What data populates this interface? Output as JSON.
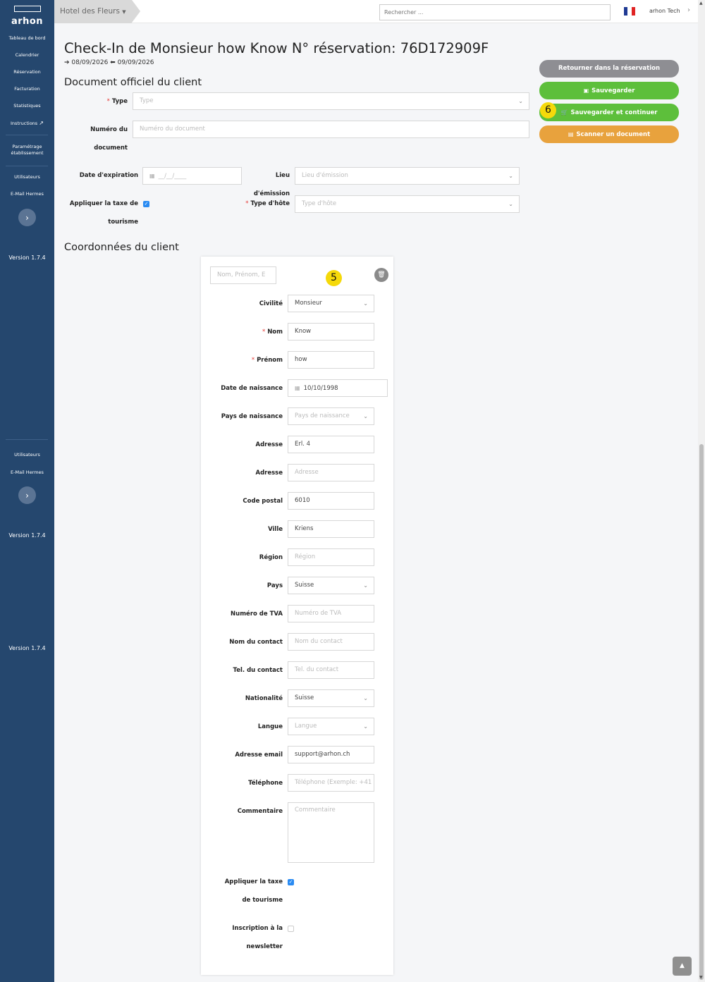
{
  "sidebar": {
    "logo": "arhon",
    "items": [
      "Tableau de bord",
      "Calendrier",
      "Réservation",
      "Facturation",
      "Statistiques",
      "Instructions"
    ],
    "settings": "Paramétrage établissement",
    "secondary": [
      "Utilisateurs",
      "E-Mail Hermes"
    ],
    "version": "Version 1.7.4"
  },
  "topbar": {
    "hotel": "Hotel des Fleurs",
    "search_placeholder": "Rechercher ...",
    "user": "arhon Tech",
    "flag_colors": [
      "#1f3a93",
      "#ffffff",
      "#e02424"
    ]
  },
  "header": {
    "title": "Check-In de Monsieur how Know N° réservation: 76D172909F",
    "arrival": "08/09/2026",
    "departure": "09/09/2026"
  },
  "actions": {
    "back": "Retourner dans la réservation",
    "save": "Sauvegarder",
    "save_continue": "Sauvegarder et continuer",
    "scan": "Scanner un document"
  },
  "markers": {
    "save_continue": "6",
    "client_card": "5"
  },
  "document": {
    "section_title": "Document officiel du client",
    "type_label": "Type",
    "type_placeholder": "Type",
    "number_label": "Numéro du document",
    "number_placeholder": "Numéro du document",
    "expiry_label": "Date d'expiration",
    "expiry_placeholder": "__/__/____",
    "emission_label": "Lieu d'émission",
    "emission_placeholder": "Lieu d'émission",
    "tax_label": "Appliquer la taxe de tourisme",
    "tax_checked": true,
    "guest_type_label": "Type d'hôte",
    "guest_type_placeholder": "Type d'hôte"
  },
  "client": {
    "section_title": "Coordonnées du client",
    "search_placeholder": "Nom, Prénom, E",
    "civility_label": "Civilité",
    "civility_value": "Monsieur",
    "lastname_label": "Nom",
    "lastname_value": "Know",
    "firstname_label": "Prénom",
    "firstname_value": "how",
    "birthdate_label": "Date de naissance",
    "birthdate_value": "10/10/1998",
    "birth_country_label": "Pays de naissance",
    "birth_country_placeholder": "Pays de naissance",
    "address1_label": "Adresse",
    "address1_value": "Erl. 4",
    "address2_label": "Adresse",
    "address2_placeholder": "Adresse",
    "zip_label": "Code postal",
    "zip_value": "6010",
    "city_label": "Ville",
    "city_value": "Kriens",
    "region_label": "Région",
    "region_placeholder": "Région",
    "country_label": "Pays",
    "country_value": "Suisse",
    "vat_label": "Numéro de TVA",
    "vat_placeholder": "Numéro de TVA",
    "contact_name_label": "Nom du contact",
    "contact_name_placeholder": "Nom du contact",
    "contact_tel_label": "Tel. du contact",
    "contact_tel_placeholder": "Tel. du contact",
    "nationality_label": "Nationalité",
    "nationality_value": "Suisse",
    "language_label": "Langue",
    "language_placeholder": "Langue",
    "email_label": "Adresse email",
    "email_value": "support@arhon.ch",
    "phone_label": "Téléphone",
    "phone_placeholder": "Téléphone (Exemple: +41",
    "comment_label": "Commentaire",
    "comment_placeholder": "Commentaire",
    "tax_label": "Appliquer la taxe de tourisme",
    "tax_checked": true,
    "newsletter_label": "Inscription à la newsletter",
    "newsletter_checked": false
  }
}
